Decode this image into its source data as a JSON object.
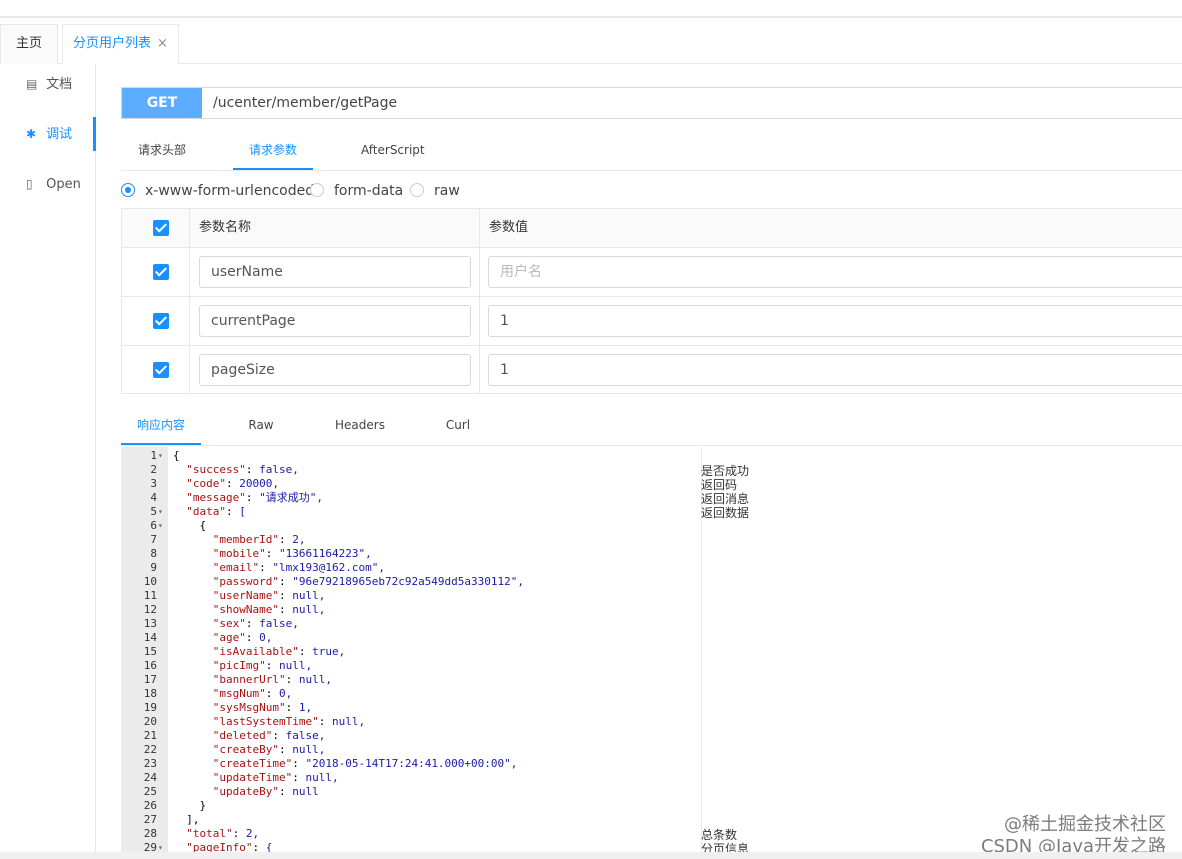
{
  "tabs": [
    {
      "label": "主页"
    },
    {
      "label": "分页用户列表",
      "close": "×"
    }
  ],
  "sidebar": [
    {
      "label": "文档",
      "icon": "document-icon"
    },
    {
      "label": "调试",
      "icon": "bug-icon"
    },
    {
      "label": "Open",
      "icon": "file-icon"
    }
  ],
  "request": {
    "method": "GET",
    "url": "/ucenter/member/getPage"
  },
  "request_tabs": [
    "请求头部",
    "请求参数",
    "AfterScript"
  ],
  "body_types": [
    "x-www-form-urlencoded",
    "form-data",
    "raw"
  ],
  "params": {
    "header_name": "参数名称",
    "header_value": "参数值",
    "rows": [
      {
        "name": "userName",
        "value": "",
        "placeholder": "用户名"
      },
      {
        "name": "currentPage",
        "value": "1",
        "placeholder": ""
      },
      {
        "name": "pageSize",
        "value": "1",
        "placeholder": ""
      }
    ]
  },
  "response_tabs": [
    "响应内容",
    "Raw",
    "Headers",
    "Curl"
  ],
  "response_lines": [
    {
      "n": "1",
      "fold": "▾",
      "code": "{"
    },
    {
      "n": "2",
      "fold": "",
      "code": "  \"success\": false,"
    },
    {
      "n": "3",
      "fold": "",
      "code": "  \"code\": 20000,"
    },
    {
      "n": "4",
      "fold": "",
      "code": "  \"message\": \"请求成功\","
    },
    {
      "n": "5",
      "fold": "▾",
      "code": "  \"data\": ["
    },
    {
      "n": "6",
      "fold": "▾",
      "code": "    {"
    },
    {
      "n": "7",
      "fold": "",
      "code": "      \"memberId\": 2,"
    },
    {
      "n": "8",
      "fold": "",
      "code": "      \"mobile\": \"13661164223\","
    },
    {
      "n": "9",
      "fold": "",
      "code": "      \"email\": \"lmx193@162.com\","
    },
    {
      "n": "10",
      "fold": "",
      "code": "      \"password\": \"96e79218965eb72c92a549dd5a330112\","
    },
    {
      "n": "11",
      "fold": "",
      "code": "      \"userName\": null,"
    },
    {
      "n": "12",
      "fold": "",
      "code": "      \"showName\": null,"
    },
    {
      "n": "13",
      "fold": "",
      "code": "      \"sex\": false,"
    },
    {
      "n": "14",
      "fold": "",
      "code": "      \"age\": 0,"
    },
    {
      "n": "15",
      "fold": "",
      "code": "      \"isAvailable\": true,"
    },
    {
      "n": "16",
      "fold": "",
      "code": "      \"picImg\": null,"
    },
    {
      "n": "17",
      "fold": "",
      "code": "      \"bannerUrl\": null,"
    },
    {
      "n": "18",
      "fold": "",
      "code": "      \"msgNum\": 0,"
    },
    {
      "n": "19",
      "fold": "",
      "code": "      \"sysMsgNum\": 1,"
    },
    {
      "n": "20",
      "fold": "",
      "code": "      \"lastSystemTime\": null,"
    },
    {
      "n": "21",
      "fold": "",
      "code": "      \"deleted\": false,"
    },
    {
      "n": "22",
      "fold": "",
      "code": "      \"createBy\": null,"
    },
    {
      "n": "23",
      "fold": "",
      "code": "      \"createTime\": \"2018-05-14T17:24:41.000+00:00\","
    },
    {
      "n": "24",
      "fold": "",
      "code": "      \"updateTime\": null,"
    },
    {
      "n": "25",
      "fold": "",
      "code": "      \"updateBy\": null"
    },
    {
      "n": "26",
      "fold": "",
      "code": "    }"
    },
    {
      "n": "27",
      "fold": "",
      "code": "  ],"
    },
    {
      "n": "28",
      "fold": "",
      "code": "  \"total\": 2,"
    },
    {
      "n": "29",
      "fold": "▾",
      "code": "  \"pageInfo\": {"
    }
  ],
  "comments": [
    {
      "line": 2,
      "text": "是否成功"
    },
    {
      "line": 3,
      "text": "返回码"
    },
    {
      "line": 4,
      "text": "返回消息"
    },
    {
      "line": 5,
      "text": "返回数据"
    },
    {
      "line": 28,
      "text": "总条数"
    },
    {
      "line": 29,
      "text": "分页信息"
    }
  ],
  "watermark": {
    "line1": "@稀土掘金技术社区",
    "line2": "CSDN @Java开发之路"
  },
  "colors": {
    "accent": "#1890ff",
    "method_bg": "#5cadff"
  }
}
